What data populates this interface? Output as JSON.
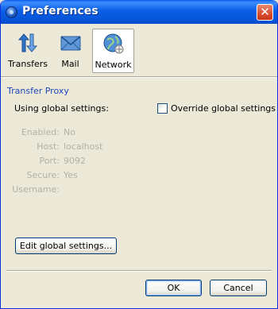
{
  "window": {
    "title": "Preferences",
    "title_icon": "app-icon",
    "close_icon": "close-icon"
  },
  "toolbar": {
    "items": [
      {
        "label": "Transfers",
        "icon": "transfers-icon",
        "selected": false
      },
      {
        "label": "Mail",
        "icon": "mail-icon",
        "selected": false
      },
      {
        "label": "Network",
        "icon": "network-icon",
        "selected": true
      }
    ]
  },
  "section": {
    "title": "Transfer Proxy",
    "using_label": "Using global settings:",
    "override_label": "Override global settings",
    "override_checked": false
  },
  "fields": [
    {
      "label": "Enabled:",
      "value": "No"
    },
    {
      "label": "Host:",
      "value": "localhost"
    },
    {
      "label": "Port:",
      "value": "9092"
    },
    {
      "label": "Secure:",
      "value": "Yes"
    },
    {
      "label": "Username:",
      "value": ""
    }
  ],
  "buttons": {
    "edit": "Edit global settings...",
    "ok": "OK",
    "cancel": "Cancel"
  },
  "colors": {
    "section_title": "#2147b8",
    "disabled_text": "#b3b0a5",
    "titlebar": "#0a5fe6",
    "close": "#d84d2d"
  }
}
